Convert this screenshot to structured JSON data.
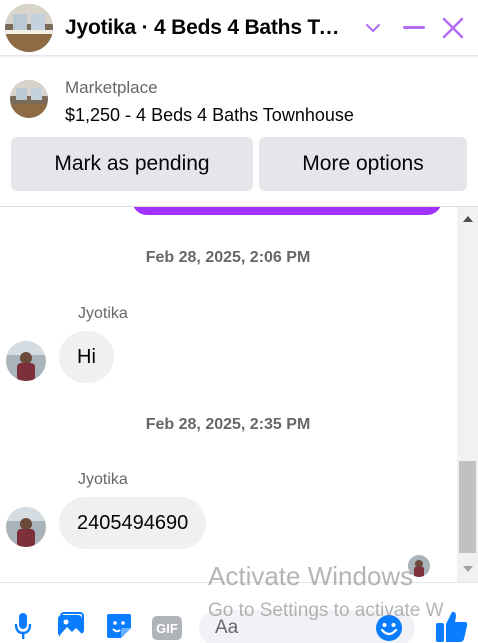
{
  "colors": {
    "accent": "#a033ff",
    "messenger_blue": "#0a7cff",
    "bubble_gray": "#f0f0f0",
    "button_gray": "#e4e6eb"
  },
  "header": {
    "title": "Jyotika · 4 Beds 4 Baths To…",
    "thumb_icon": "listing-photo",
    "chevron_icon": "chevron-down-icon",
    "minimize_icon": "minimize-icon",
    "close_icon": "close-icon"
  },
  "marketplace": {
    "label": "Marketplace",
    "listing_title": "$1,250 - 4 Beds 4 Baths Townhouse",
    "buttons": {
      "pending": "Mark as pending",
      "more": "More options"
    }
  },
  "messages": [
    {
      "timestamp": "Feb 28, 2025, 2:06 PM",
      "sender": "Jyotika",
      "text": "Hi"
    },
    {
      "timestamp": "Feb 28, 2025, 2:35 PM",
      "sender": "Jyotika",
      "text": "2405494690"
    }
  ],
  "composer": {
    "placeholder": "Aa",
    "icons": [
      "microphone-icon",
      "photo-icon",
      "sticker-icon",
      "gif-icon",
      "emoji-icon",
      "thumbs-up-icon"
    ],
    "gif_label": "GIF"
  },
  "watermark": {
    "line1": "Activate Windows",
    "line2": "Go to Settings to activate W"
  }
}
